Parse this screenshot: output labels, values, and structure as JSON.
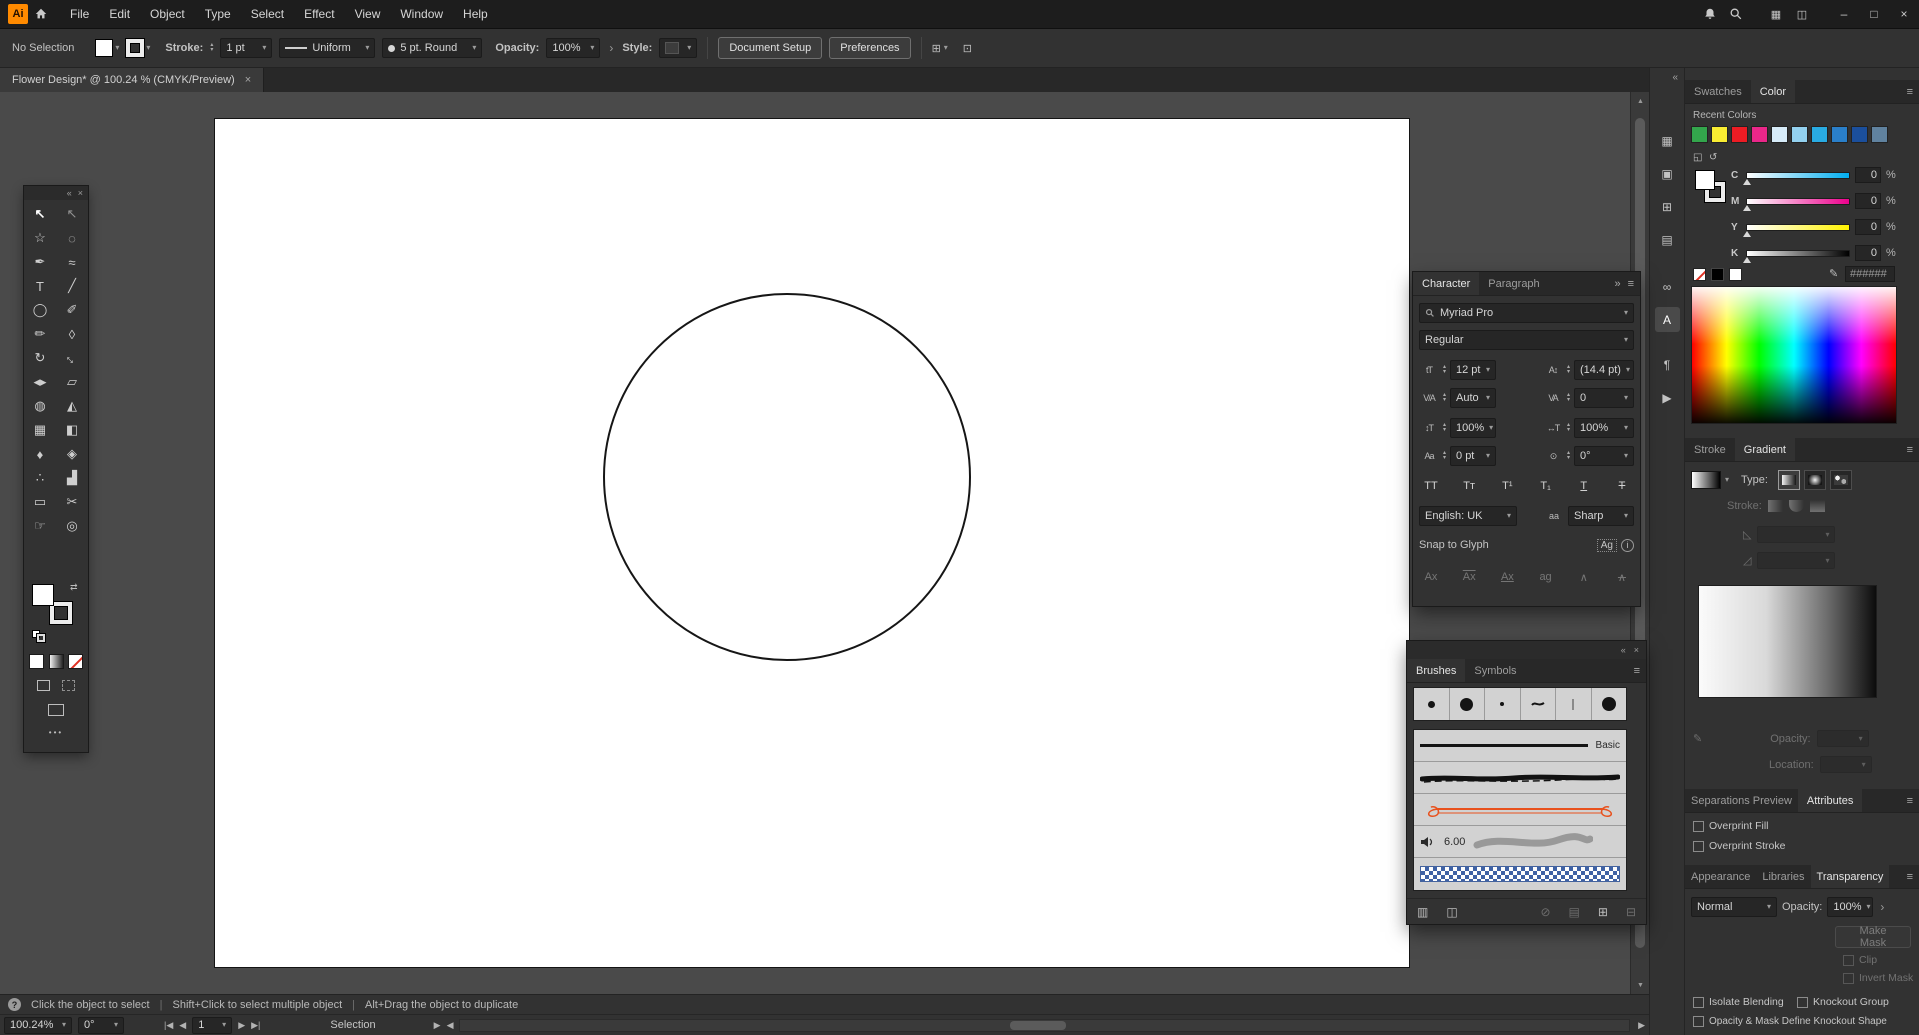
{
  "app": {
    "logo": "Ai",
    "menus": [
      "File",
      "Edit",
      "Object",
      "Type",
      "Select",
      "Effect",
      "View",
      "Window",
      "Help"
    ]
  },
  "icons": {
    "caret": "▾",
    "stepper_up": "▴",
    "stepper_down": "▾",
    "chevron_more": "›",
    "collapse_left": "«",
    "collapse_right": "»",
    "panel_menu": "≡",
    "close": "×",
    "minimize": "–",
    "maximize": "□",
    "workspace": "▦",
    "arrange_docs": "◫",
    "swap": "⇄",
    "ellipsis": "•••",
    "scroll_up": "▲",
    "scroll_down": "▼",
    "scroll_left": "◀",
    "scroll_right": "▶",
    "nav_first": "|◀",
    "nav_prev": "◀",
    "nav_next": "▶",
    "nav_last": "▶|",
    "status_play": "▶",
    "help": "?",
    "info": "i",
    "pencil": "✎",
    "angle": "◺",
    "aspect": "◿",
    "align_widget": "⊞",
    "more_options": "⊡",
    "mini_grid": "◱",
    "mini_reset": "↺"
  },
  "control_bar": {
    "selection_status": "No Selection",
    "stroke_label": "Stroke:",
    "stroke_weight": "1 pt",
    "width_profile": "Uniform",
    "brush_definition": "5 pt. Round",
    "opacity_label": "Opacity:",
    "opacity_value": "100%",
    "style_label": "Style:",
    "document_setup_label": "Document Setup",
    "preferences_label": "Preferences"
  },
  "document_tab": {
    "title": "Flower Design* @ 100.24 % (CMYK/Preview)"
  },
  "tools": [
    {
      "name": "selection-tool",
      "glyph": "↖",
      "cls": "sel"
    },
    {
      "name": "direct-selection-tool",
      "glyph": "↖",
      "cls": "dim"
    },
    {
      "name": "magic-wand-tool",
      "glyph": "☆"
    },
    {
      "name": "lasso-tool",
      "glyph": "◌"
    },
    {
      "name": "pen-tool",
      "glyph": "✒"
    },
    {
      "name": "curvature-tool",
      "glyph": "≈"
    },
    {
      "name": "type-tool",
      "glyph": "T"
    },
    {
      "name": "line-segment-tool",
      "glyph": "╱"
    },
    {
      "name": "ellipse-tool",
      "glyph": "◯"
    },
    {
      "name": "paintbrush-tool",
      "glyph": "✐"
    },
    {
      "name": "pencil-tool",
      "glyph": "✏"
    },
    {
      "name": "eraser-tool",
      "glyph": "◊"
    },
    {
      "name": "rotate-tool",
      "glyph": "↻"
    },
    {
      "name": "scale-tool",
      "glyph": "↔",
      "cls": "rot45"
    },
    {
      "name": "width-tool",
      "glyph": "◂▸"
    },
    {
      "name": "free-transform-tool",
      "glyph": "▱"
    },
    {
      "name": "shape-builder-tool",
      "glyph": "◍"
    },
    {
      "name": "perspective-grid-tool",
      "glyph": "◭"
    },
    {
      "name": "mesh-tool",
      "glyph": "▦"
    },
    {
      "name": "gradient-tool",
      "glyph": "◧"
    },
    {
      "name": "eyedropper-tool",
      "glyph": "♦"
    },
    {
      "name": "blend-tool",
      "glyph": "◈"
    },
    {
      "name": "symbol-sprayer-tool",
      "glyph": "∴"
    },
    {
      "name": "column-graph-tool",
      "glyph": "▟"
    },
    {
      "name": "artboard-tool",
      "glyph": "▭"
    },
    {
      "name": "slice-tool",
      "glyph": "✂"
    },
    {
      "name": "hand-tool",
      "glyph": "☞"
    },
    {
      "name": "zoom-tool",
      "glyph": "◎"
    }
  ],
  "dock_icons": [
    {
      "name": "artboards-panel-icon",
      "glyph": "▦"
    },
    {
      "name": "asset-export-panel-icon",
      "glyph": "▣"
    },
    {
      "name": "swatches-panel-icon",
      "glyph": "⊞"
    },
    {
      "name": "layers-panel-icon",
      "glyph": "▤"
    },
    {
      "name": "links-panel-icon",
      "glyph": "∞"
    },
    {
      "name": "character-panel-icon",
      "glyph": "A",
      "active": true
    },
    {
      "name": "paragraph-panel-icon",
      "glyph": "¶"
    },
    {
      "name": "actions-panel-icon",
      "glyph": "▶"
    }
  ],
  "swatches_panel": {
    "tab_swatches": "Swatches",
    "tab_color": "Color",
    "recent_colors_label": "Recent Colors",
    "recent_colors": [
      "#33a64c",
      "#f9ed32",
      "#ed1c24",
      "#ea2789",
      "#d7ecf9",
      "#93d1ef",
      "#29abe2",
      "#2a7fc9",
      "#1b4f9c",
      "#60829f"
    ],
    "sliders": [
      {
        "label": "C",
        "value": "0",
        "unit": "%",
        "track": "linear-gradient(90deg,#ffffff,#00adef)"
      },
      {
        "label": "M",
        "value": "0",
        "unit": "%",
        "track": "linear-gradient(90deg,#ffffff,#ec008c)"
      },
      {
        "label": "Y",
        "value": "0",
        "unit": "%",
        "track": "linear-gradient(90deg,#ffffff,#fff200)"
      },
      {
        "label": "K",
        "value": "0",
        "unit": "%",
        "track": "linear-gradient(90deg,#ffffff,#000000)"
      }
    ],
    "hex_value": "######"
  },
  "gradient_panel": {
    "tab_stroke": "Stroke",
    "tab_gradient": "Gradient",
    "type_label": "Type:",
    "stroke_label": "Stroke:",
    "opacity_label": "Opacity:",
    "location_label": "Location:"
  },
  "attributes_panel": {
    "tab_separations": "Separations Preview",
    "tab_attributes": "Attributes",
    "overprint_fill": "Overprint Fill",
    "overprint_stroke": "Overprint Stroke"
  },
  "transparency_panel": {
    "tab_appearance": "Appearance",
    "tab_libraries": "Libraries",
    "tab_transparency": "Transparency",
    "blend_mode": "Normal",
    "opacity_label": "Opacity:",
    "opacity_value": "100%",
    "make_mask_label": "Make Mask",
    "clip_label": "Clip",
    "invert_mask_label": "Invert Mask",
    "isolate_blending_label": "Isolate Blending",
    "knockout_group_label": "Knockout Group",
    "knockout_shape_label": "Opacity & Mask Define Knockout Shape"
  },
  "character_panel": {
    "tab_character": "Character",
    "tab_paragraph": "Paragraph",
    "font_family": "Myriad Pro",
    "font_style": "Regular",
    "font_size": "12 pt",
    "leading": "(14.4 pt)",
    "kerning": "Auto",
    "tracking": "0",
    "vertical_scale": "100%",
    "horizontal_scale": "100%",
    "baseline_shift": "0 pt",
    "character_rotation": "0°",
    "language": "English: UK",
    "anti_aliasing": "Sharp",
    "aa_icon": "aa",
    "snap_to_glyph_label": "Snap to Glyph",
    "glyph_badge": "Ag",
    "icons": {
      "size": "tT",
      "leading": "A↕",
      "kerning": "V/A",
      "tracking": "VA",
      "vertical": "↕T",
      "horizontal": "↔T",
      "baseline": "Aa",
      "rotation": "⊙"
    },
    "case_buttons": [
      {
        "label": "TT"
      },
      {
        "label": "Tᴛ"
      },
      {
        "label": "T¹"
      },
      {
        "label": "T₁"
      },
      {
        "label": "T",
        "cls": "ul"
      },
      {
        "label": "T",
        "cls": "st"
      }
    ],
    "snap_buttons": [
      {
        "label": "Ax"
      },
      {
        "label": "Ax",
        "cls": "ov"
      },
      {
        "label": "Ax",
        "cls": "ul"
      },
      {
        "label": "ag"
      },
      {
        "label": "∧"
      },
      {
        "label": "∧",
        "cls": "st"
      }
    ]
  },
  "brushes_panel": {
    "tab_brushes": "Brushes",
    "tab_symbols": "Symbols",
    "basic_label": "Basic",
    "scatter_value": "6.00"
  },
  "status_bar": {
    "divider": "|",
    "hints": [
      "Click the object to select",
      "Shift+Click to select multiple object",
      "Alt+Drag the object to duplicate"
    ]
  },
  "bottom_bar": {
    "zoom": "100.24%",
    "rotation": "0°",
    "artboard": "1",
    "status": "Selection"
  }
}
